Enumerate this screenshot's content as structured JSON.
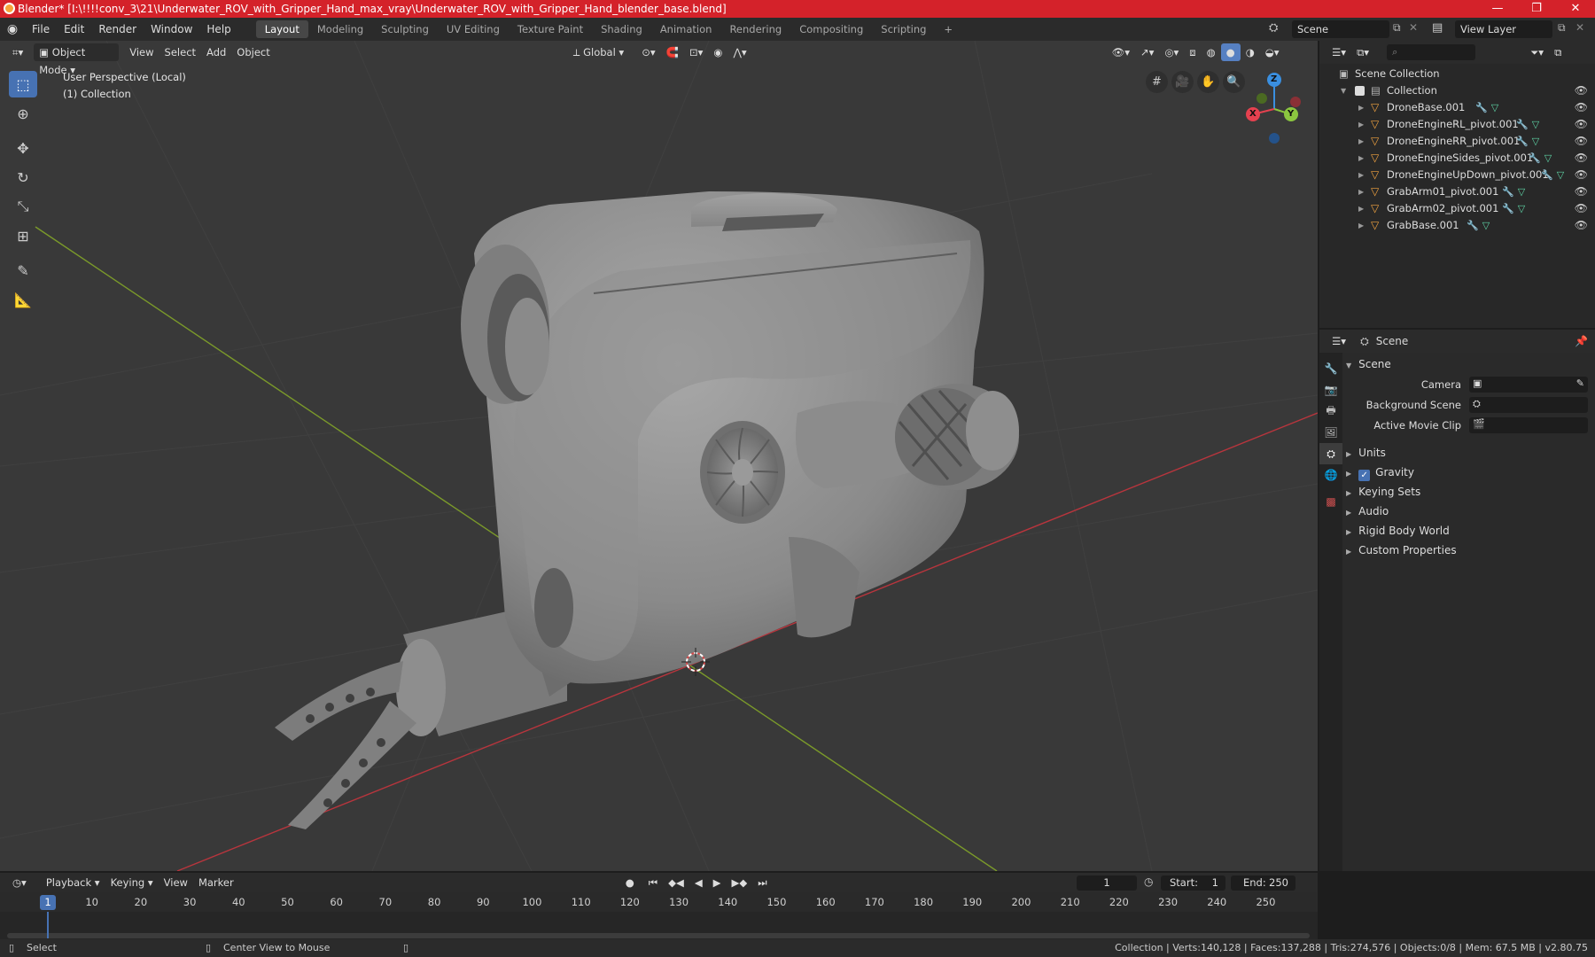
{
  "window": {
    "title": "Blender* [I:\\!!!!conv_3\\21\\Underwater_ROV_with_Gripper_Hand_max_vray\\Underwater_ROV_with_Gripper_Hand_blender_base.blend]",
    "controls": [
      "—",
      "❐",
      "✕"
    ]
  },
  "menubar": {
    "items": [
      "File",
      "Edit",
      "Render",
      "Window",
      "Help"
    ],
    "workspaces": [
      "Layout",
      "Modeling",
      "Sculpting",
      "UV Editing",
      "Texture Paint",
      "Shading",
      "Animation",
      "Rendering",
      "Compositing",
      "Scripting"
    ],
    "add_tab": "+",
    "scene": "Scene",
    "view_layer": "View Layer"
  },
  "viewport": {
    "mode": "Object Mode",
    "menus": [
      "View",
      "Select",
      "Add",
      "Object"
    ],
    "transform": "Global",
    "info_line1": "User Perspective (Local)",
    "info_line2": "(1) Collection",
    "gizmo": {
      "x": "X",
      "y": "Y",
      "z": "Z"
    }
  },
  "outliner": {
    "scene_collection": "Scene Collection",
    "collection": "Collection",
    "objects": [
      "DroneBase.001",
      "DroneEngineRL_pivot.001",
      "DroneEngineRR_pivot.001",
      "DroneEngineSides_pivot.001",
      "DroneEngineUpDown_pivot.001",
      "GrabArm01_pivot.001",
      "GrabArm02_pivot.001",
      "GrabBase.001"
    ]
  },
  "properties": {
    "header": "Scene",
    "panel": "Scene",
    "camera_label": "Camera",
    "background_label": "Background Scene",
    "movieclip_label": "Active Movie Clip",
    "subpanels": [
      "Units",
      "Gravity",
      "Keying Sets",
      "Audio",
      "Rigid Body World",
      "Custom Properties"
    ],
    "gravity_checked": true
  },
  "timeline": {
    "menus": [
      "Playback",
      "Keying",
      "View",
      "Marker"
    ],
    "current_frame": "1",
    "start_label": "Start:",
    "start": "1",
    "end_label": "End:",
    "end": "250",
    "ticks": [
      "10",
      "20",
      "30",
      "40",
      "50",
      "60",
      "70",
      "80",
      "90",
      "100",
      "110",
      "120",
      "130",
      "140",
      "150",
      "160",
      "170",
      "180",
      "190",
      "200",
      "210",
      "220",
      "230",
      "240",
      "250"
    ],
    "cursor_frame": "1"
  },
  "statusbar": {
    "left": "Select",
    "middle": "Center View to Mouse",
    "right": "Collection | Verts:140,128 | Faces:137,288 | Tris:274,576 | Objects:0/8 | Mem: 67.5 MB | v2.80.75"
  },
  "colors": {
    "titlebar": "#d4222a",
    "accent": "#4772b3",
    "object_icon": "#f0a240",
    "axis_x": "#e5414f",
    "axis_y": "#8bc63f",
    "axis_z": "#3a8fe0"
  }
}
